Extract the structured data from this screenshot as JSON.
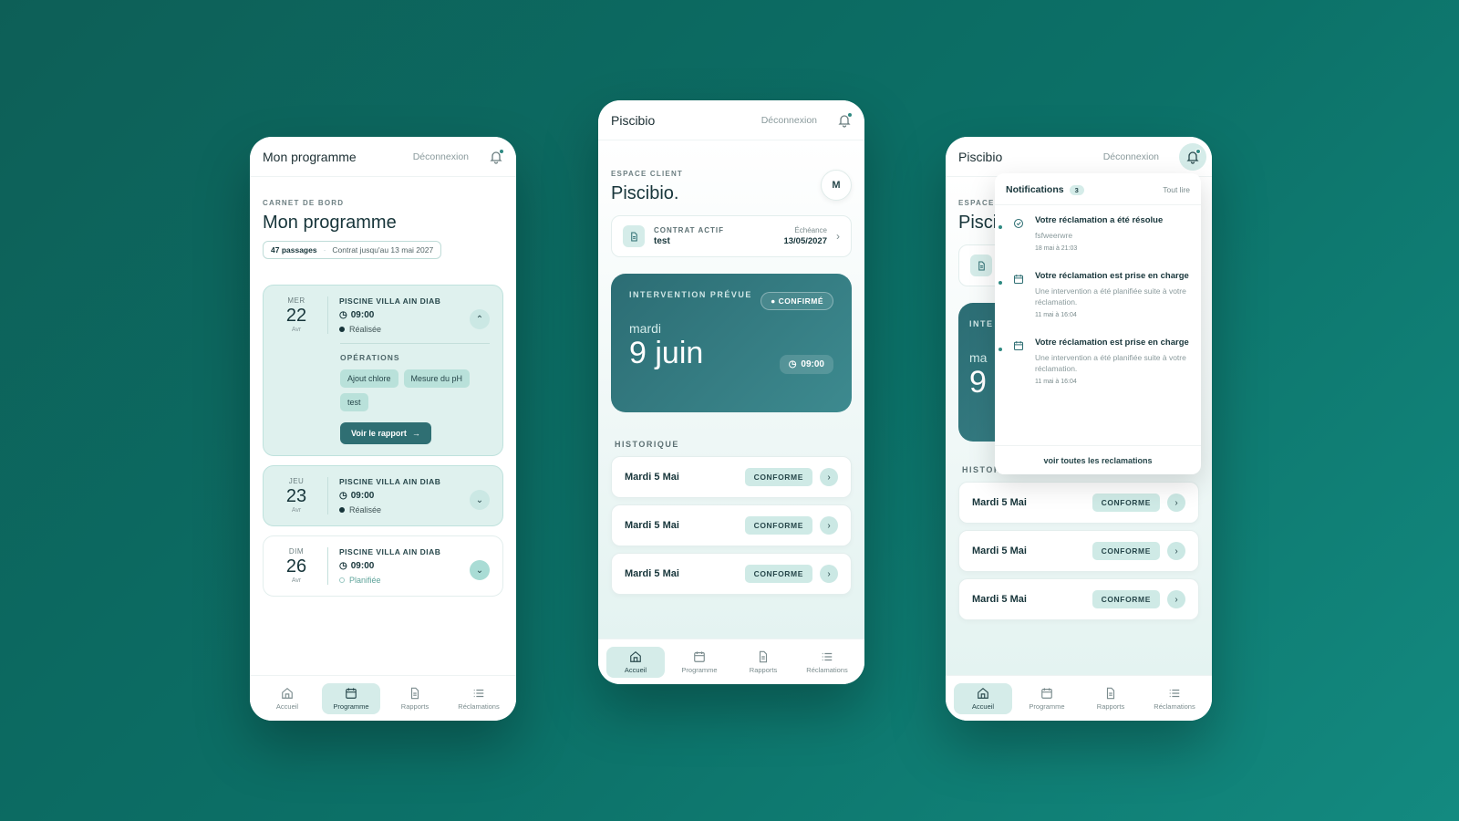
{
  "colors": {
    "accent": "#2f6f73",
    "accent_soft": "#d5ece9",
    "background": "#0c7168"
  },
  "phone1": {
    "topbar": {
      "title": "Mon programme",
      "logout": "Déconnexion"
    },
    "eyebrow": "CARNET DE BORD",
    "title": "Mon programme",
    "passages": "47 passages",
    "contract": "Contrat jusqu'au 13 mai 2027",
    "cards": [
      {
        "dow": "MER",
        "num": "22",
        "mon": "Avr",
        "site": "PISCINE VILLA AIN DIAB",
        "time": "09:00",
        "status": "Réalisée",
        "expanded": true
      },
      {
        "dow": "JEU",
        "num": "23",
        "mon": "Avr",
        "site": "PISCINE VILLA AIN DIAB",
        "time": "09:00",
        "status": "Réalisée",
        "expanded": false
      },
      {
        "dow": "DIM",
        "num": "26",
        "mon": "Avr",
        "site": "PISCINE VILLA AIN DIAB",
        "time": "09:00",
        "status": "Planifiée",
        "expanded": false
      }
    ],
    "operations_title": "OPÉRATIONS",
    "tags": [
      "Ajout chlore",
      "Mesure du pH",
      "test"
    ],
    "report_button": "Voir le rapport",
    "active_tab": "Programme"
  },
  "tabs": [
    "Accueil",
    "Programme",
    "Rapports",
    "Réclamations"
  ],
  "phone2": {
    "topbar": {
      "title": "Piscibio",
      "logout": "Déconnexion"
    },
    "eyebrow": "ESPACE CLIENT",
    "brand": "Piscibio.",
    "avatar": "M",
    "contract": {
      "label": "CONTRAT ACTIF",
      "value": "test",
      "due_label": "Échéance",
      "due": "13/05/2027"
    },
    "hero": {
      "eyebrow": "INTERVENTION PRÉVUE",
      "status": "CONFIRMÉ",
      "day": "mardi",
      "date": "9 juin",
      "time": "09:00"
    },
    "history_title": "HISTORIQUE",
    "history": [
      {
        "date": "Mardi 5 Mai",
        "badge": "CONFORME"
      },
      {
        "date": "Mardi 5 Mai",
        "badge": "CONFORME"
      },
      {
        "date": "Mardi 5 Mai",
        "badge": "CONFORME"
      }
    ],
    "active_tab": "Accueil"
  },
  "phone3": {
    "topbar": {
      "title": "Piscibio",
      "logout": "Déconnexion"
    },
    "eyebrow_partial": "ESPACE",
    "brand_partial": "Pisci",
    "hero_partial": {
      "eyebrow": "INTE",
      "day": "ma",
      "date": "9"
    },
    "history_title": "HISTORIQUE",
    "history": [
      {
        "date": "Mardi 5 Mai",
        "badge": "CONFORME"
      },
      {
        "date": "Mardi 5 Mai",
        "badge": "CONFORME"
      },
      {
        "date": "Mardi 5 Mai",
        "badge": "CONFORME"
      }
    ],
    "notifications": {
      "title": "Notifications",
      "count": "3",
      "read_all": "Tout lire",
      "items": [
        {
          "icon": "check-circle-icon",
          "title": "Votre réclamation a été résolue",
          "sub": "fsfweerwre",
          "date": "18 mai à 21:03"
        },
        {
          "icon": "calendar-icon",
          "title": "Votre réclamation est prise en charge",
          "sub": "Une intervention a été planifiée suite à votre réclamation.",
          "date": "11 mai à 16:04"
        },
        {
          "icon": "calendar-icon",
          "title": "Votre réclamation est prise en charge",
          "sub": "Une intervention a été planifiée suite à votre réclamation.",
          "date": "11 mai à 16:04"
        }
      ],
      "footer": "voir toutes les reclamations"
    },
    "active_tab": "Accueil"
  }
}
